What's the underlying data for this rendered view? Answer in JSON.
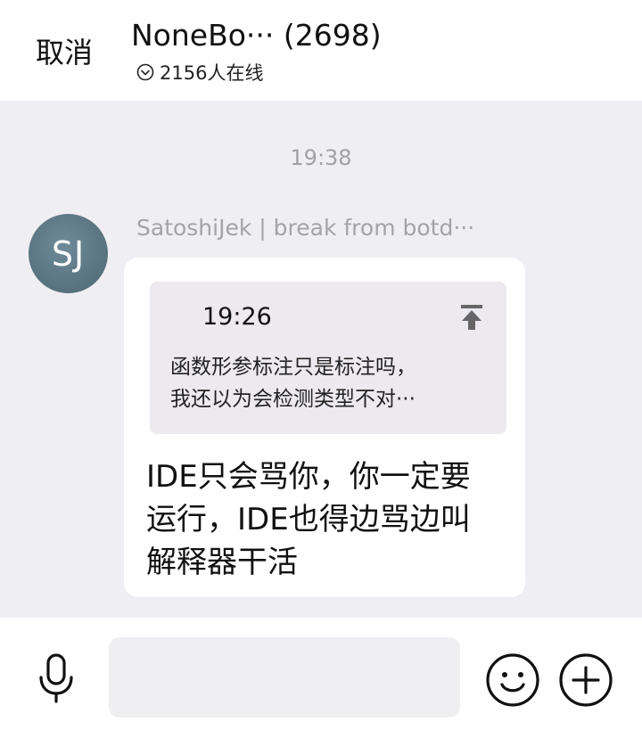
{
  "header": {
    "cancel_label": "取消",
    "title": "NoneBo··· (2698)",
    "online_text": "2156人在线"
  },
  "chat": {
    "time_divider": "19:38",
    "message": {
      "avatar_initials": "SJ",
      "sender": "SatoshiJek | break from botd···",
      "quote": {
        "time": "19:26",
        "line1": "函数形参标注只是标注吗，",
        "line2": "我还以为会检测类型不对···"
      },
      "text_line1": "IDE只会骂你，你一定要",
      "text_line2": "运行，IDE也得边骂边叫",
      "text_line3": "解释器干活"
    }
  },
  "input": {
    "text_value": "",
    "icons": [
      "microphone-icon",
      "emoji-icon",
      "plus-icon"
    ]
  }
}
